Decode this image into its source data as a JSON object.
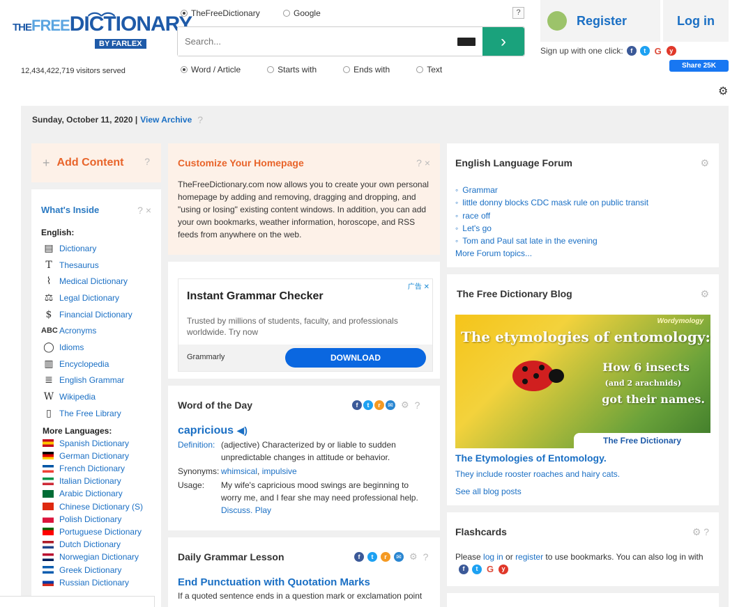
{
  "header": {
    "logo": {
      "the": "THE",
      "free": "FREE",
      "dictionary": "DICTIONARY",
      "farlex": "BY FARLEX"
    },
    "visitors": "12,434,422,719 visitors served",
    "source_options": [
      "TheFreeDictionary",
      "Google"
    ],
    "help": "?",
    "search": {
      "placeholder": "Search...",
      "go": "›"
    },
    "modes": [
      "Word / Article",
      "Starts with",
      "Ends with",
      "Text"
    ],
    "register": "Register",
    "login": "Log in",
    "signup_text": "Sign up with one click:",
    "share": "Share 25K",
    "settings_icon": "gear-icon"
  },
  "datebar": {
    "date": "Sunday, October 11, 2020 |",
    "archive": "View Archive",
    "help": "?"
  },
  "add_content": {
    "plus": "+",
    "label": "Add Content",
    "help": "?"
  },
  "whats_inside": {
    "title": "What's Inside",
    "tools": "?  ×",
    "english_label": "English:",
    "items": [
      {
        "icon": "▤",
        "label": "Dictionary"
      },
      {
        "icon": "T",
        "label": "Thesaurus"
      },
      {
        "icon": "⌇",
        "label": "Medical Dictionary"
      },
      {
        "icon": "⚖",
        "label": "Legal Dictionary"
      },
      {
        "icon": "$",
        "label": "Financial Dictionary"
      },
      {
        "icon": "ABC",
        "label": "Acronyms"
      },
      {
        "icon": "◯",
        "label": "Idioms"
      },
      {
        "icon": "▥",
        "label": "Encyclopedia"
      },
      {
        "icon": "≣",
        "label": "English Grammar"
      },
      {
        "icon": "W",
        "label": "Wikipedia"
      },
      {
        "icon": "▯",
        "label": "The Free Library"
      }
    ],
    "languages_label": "More Languages:",
    "languages": [
      {
        "label": "Spanish Dictionary",
        "colors": [
          "#c60b1e",
          "#ffc400",
          "#c60b1e"
        ]
      },
      {
        "label": "German Dictionary",
        "colors": [
          "#000000",
          "#dd0000",
          "#ffce00"
        ]
      },
      {
        "label": "French Dictionary",
        "colors": [
          "#0055a4",
          "#ffffff",
          "#ef4135"
        ]
      },
      {
        "label": "Italian Dictionary",
        "colors": [
          "#009246",
          "#ffffff",
          "#ce2b37"
        ]
      },
      {
        "label": "Arabic Dictionary",
        "colors": [
          "#006c35",
          "#006c35",
          "#006c35"
        ]
      },
      {
        "label": "Chinese Dictionary (S)",
        "colors": [
          "#de2910",
          "#de2910",
          "#de2910"
        ]
      },
      {
        "label": "Polish Dictionary",
        "colors": [
          "#ffffff",
          "#dc143c",
          "#dc143c"
        ]
      },
      {
        "label": "Portuguese Dictionary",
        "colors": [
          "#006600",
          "#ff0000",
          "#ff0000"
        ]
      },
      {
        "label": "Dutch Dictionary",
        "colors": [
          "#ae1c28",
          "#ffffff",
          "#21468b"
        ]
      },
      {
        "label": "Norwegian Dictionary",
        "colors": [
          "#ba0c2f",
          "#ffffff",
          "#00205b"
        ]
      },
      {
        "label": "Greek Dictionary",
        "colors": [
          "#0d5eaf",
          "#ffffff",
          "#0d5eaf"
        ]
      },
      {
        "label": "Russian Dictionary",
        "colors": [
          "#ffffff",
          "#0039a6",
          "#d52b1e"
        ]
      }
    ]
  },
  "customize": {
    "title": "Customize Your Homepage",
    "tools": "?  ×",
    "text": "TheFreeDictionary.com now allows you to create your own personal homepage by adding and removing, dragging and dropping, and \"using or losing\" existing content windows. In addition, you can add your own bookmarks, weather information, horoscope, and RSS feeds from anywhere on the web."
  },
  "ad": {
    "badge": "广告 ✕",
    "title": "Instant Grammar Checker",
    "desc": "Trusted by millions of students, faculty, and professionals worldwide. Try now",
    "brand": "Grammarly",
    "button": "DOWNLOAD"
  },
  "wotd": {
    "title": "Word of the Day",
    "word": "capricious",
    "definition_label": "Definition:",
    "definition": "(adjective) Characterized by or liable to sudden unpredictable changes in attitude or behavior.",
    "synonyms_label": "Synonyms:",
    "synonym1": "whimsical",
    "synonym_sep": ", ",
    "synonym2": "impulsive",
    "usage_label": "Usage:",
    "usage": "My wife's capricious mood swings are beginning to worry me, and I fear she may need professional help.",
    "discuss": "Discuss.",
    "play": "Play"
  },
  "grammar": {
    "title": "Daily Grammar Lesson",
    "lesson": "End Punctuation with Quotation Marks",
    "text": "If a quoted sentence ends in a question mark or exclamation point"
  },
  "forum": {
    "title": "English Language Forum",
    "topics": [
      "Grammar",
      "little donny blocks CDC mask rule on public transit",
      "race off",
      "Let's go",
      "Tom and Paul sat late in the evening"
    ],
    "more": "More Forum topics..."
  },
  "blog": {
    "title": "The Free Dictionary Blog",
    "image": {
      "tag": "Wordymology",
      "headline": "The etymologies of entomology:",
      "line2": "How 6 insects",
      "line3": "(and 2 arachnids)",
      "line4": "got their names.",
      "brand": "The Free Dictionary"
    },
    "link": "The Etymologies of Entomology.",
    "sub": "They include rooster roaches and hairy cats.",
    "all": "See all blog posts"
  },
  "flashcards": {
    "title": "Flashcards",
    "tools": "⚙ ?",
    "t1": "Please ",
    "login": "log in",
    "t2": " or ",
    "register": "register",
    "t3": " to use bookmarks. You can also log in with"
  },
  "colors": {
    "accent_orange": "#e8642a",
    "link_blue": "#1a6fc4",
    "go_green": "#1aa27c"
  }
}
